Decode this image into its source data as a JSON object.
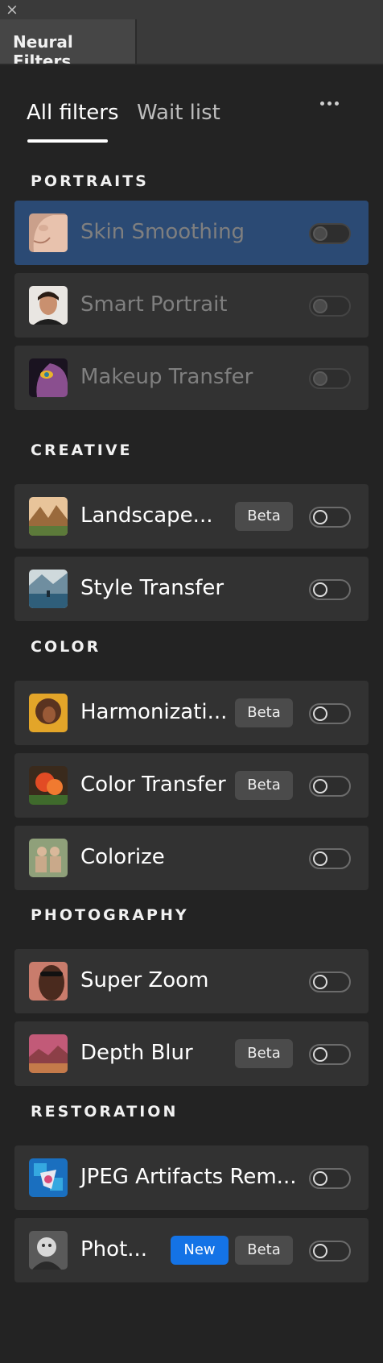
{
  "window": {
    "close_glyph": "×"
  },
  "panel": {
    "tab_title": "Neural Filters"
  },
  "tabs": [
    {
      "label": "All filters",
      "active": true
    },
    {
      "label": "Wait list",
      "active": false
    }
  ],
  "more_menu_icon": "ellipsis-icon",
  "sections": [
    {
      "title": "PORTRAITS"
    },
    {
      "title": "CREATIVE"
    },
    {
      "title": "COLOR"
    },
    {
      "title": "PHOTOGRAPHY"
    },
    {
      "title": "RESTORATION"
    }
  ],
  "filters": [
    {
      "label": "Skin Smoothing",
      "section": "PORTRAITS",
      "enabled": false,
      "available": false,
      "selected": true,
      "badges": []
    },
    {
      "label": "Smart Portrait",
      "section": "PORTRAITS",
      "enabled": false,
      "available": false,
      "selected": false,
      "badges": []
    },
    {
      "label": "Makeup Transfer",
      "section": "PORTRAITS",
      "enabled": false,
      "available": false,
      "selected": false,
      "badges": []
    },
    {
      "label": "Landscape...",
      "section": "CREATIVE",
      "enabled": false,
      "available": true,
      "selected": false,
      "badges": [
        "Beta"
      ]
    },
    {
      "label": "Style Transfer",
      "section": "CREATIVE",
      "enabled": false,
      "available": true,
      "selected": false,
      "badges": []
    },
    {
      "label": "Harmonizati...",
      "section": "COLOR",
      "enabled": false,
      "available": true,
      "selected": false,
      "badges": [
        "Beta"
      ]
    },
    {
      "label": "Color Transfer",
      "section": "COLOR",
      "enabled": false,
      "available": true,
      "selected": false,
      "badges": [
        "Beta"
      ]
    },
    {
      "label": "Colorize",
      "section": "COLOR",
      "enabled": false,
      "available": true,
      "selected": false,
      "badges": []
    },
    {
      "label": "Super Zoom",
      "section": "PHOTOGRAPHY",
      "enabled": false,
      "available": true,
      "selected": false,
      "badges": []
    },
    {
      "label": "Depth Blur",
      "section": "PHOTOGRAPHY",
      "enabled": false,
      "available": true,
      "selected": false,
      "badges": [
        "Beta"
      ]
    },
    {
      "label": "JPEG Artifacts Rem...",
      "section": "RESTORATION",
      "enabled": false,
      "available": true,
      "selected": false,
      "badges": []
    },
    {
      "label": "Phot...",
      "section": "RESTORATION",
      "enabled": false,
      "available": true,
      "selected": false,
      "badges": [
        "New",
        "Beta"
      ]
    }
  ],
  "colors": {
    "panel_bg": "#232323",
    "row_bg": "#323232",
    "selected_row_bg": "#2b4a74",
    "beta_badge_bg": "#4b4b4b",
    "new_badge_bg": "#1473e6"
  }
}
